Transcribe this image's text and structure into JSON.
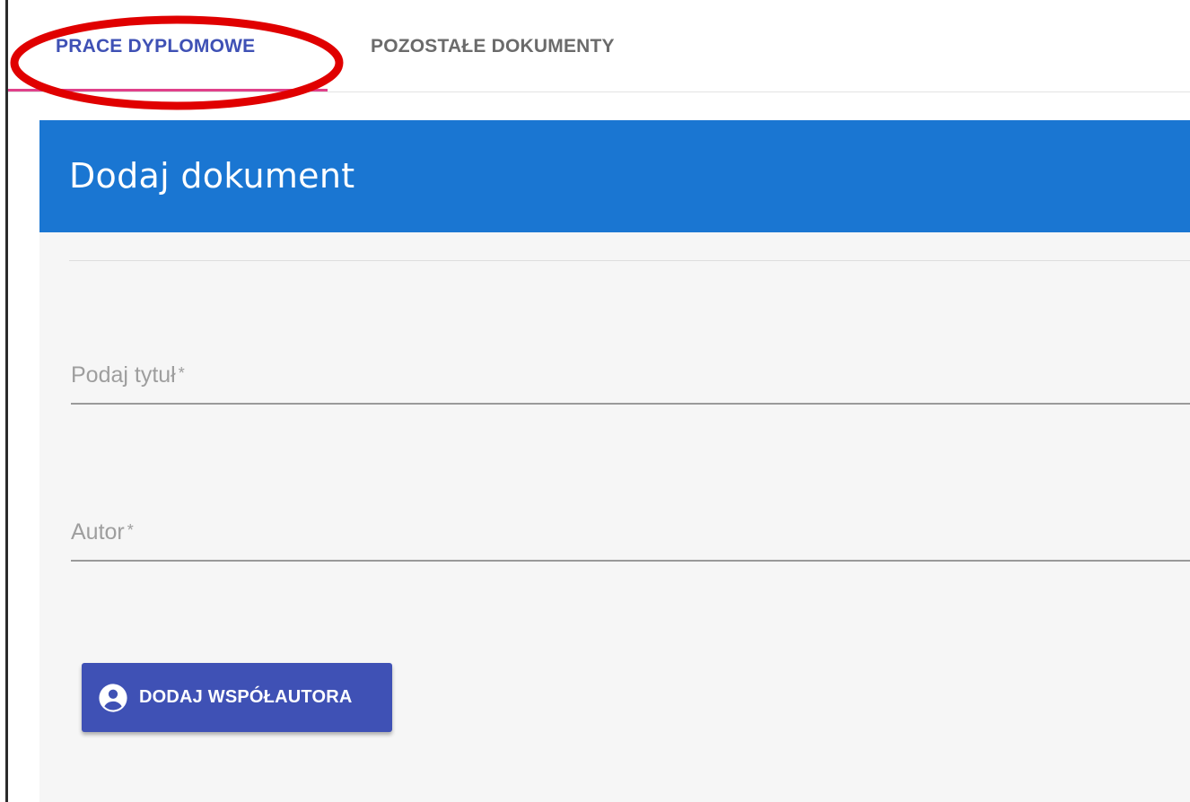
{
  "tabs": [
    {
      "label": "PRACE DYPLOMOWE",
      "active": true
    },
    {
      "label": "POZOSTAŁE DOKUMENTY",
      "active": false
    }
  ],
  "card": {
    "title": "Dodaj dokument"
  },
  "form": {
    "title_field": {
      "label": "Podaj tytuł",
      "required_mark": "*"
    },
    "author_field": {
      "label": "Autor",
      "required_mark": "*"
    },
    "add_coauthor_button": {
      "label": "DODAJ WSPÓŁAUTORA",
      "icon": "account-circle-icon"
    }
  },
  "colors": {
    "header": "#1a76d2",
    "tab_active": "#3f51b5",
    "tab_indicator": "#e0408a",
    "button": "#3f51b5",
    "annotation": "#e00000"
  }
}
